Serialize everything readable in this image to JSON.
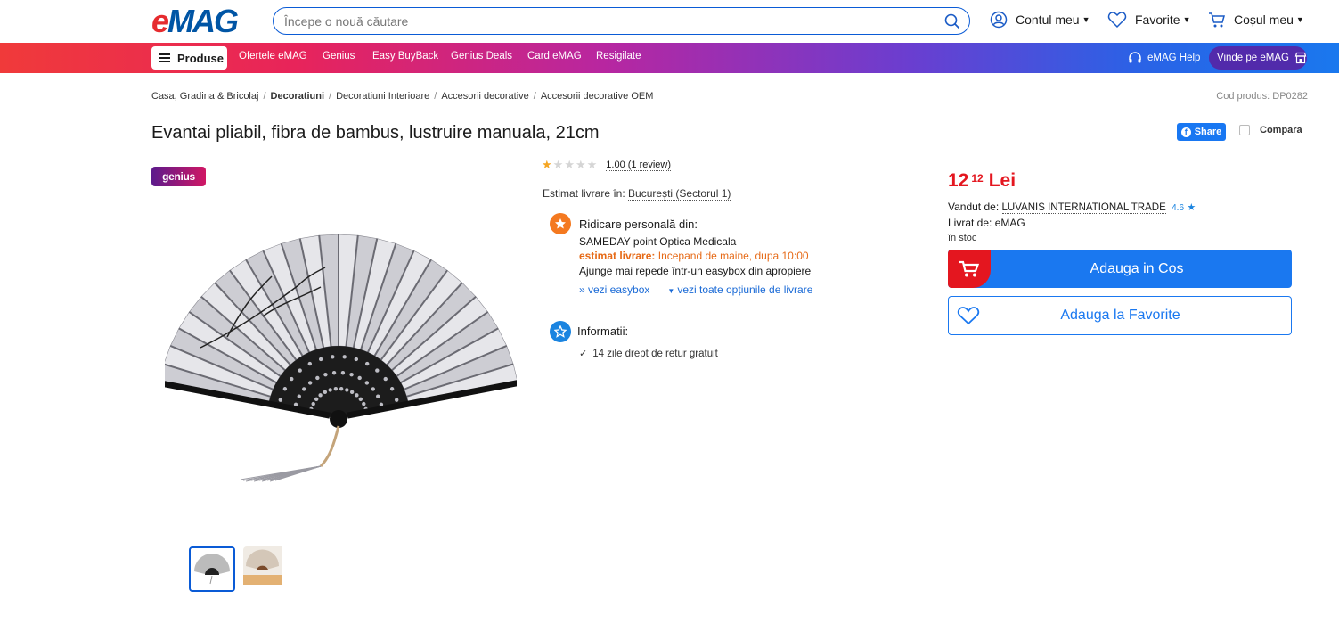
{
  "header": {
    "logo": "eMAG",
    "search_placeholder": "Începe o nouă căutare",
    "account": "Contul meu",
    "favorites": "Favorite",
    "cart": "Coșul meu"
  },
  "nav": {
    "products": "Produse",
    "items": [
      "Ofertele eMAG",
      "Genius",
      "Easy BuyBack",
      "Genius Deals",
      "Card eMAG",
      "Resigilate"
    ],
    "help": "eMAG Help",
    "sell": "Vinde pe eMAG"
  },
  "breadcrumb": [
    "Casa, Gradina & Bricolaj",
    "Decoratiuni",
    "Decoratiuni Interioare",
    "Accesorii decorative",
    "Accesorii decorative OEM"
  ],
  "product_code": "Cod produs: DP0282",
  "product": {
    "title": "Evantai pliabil, fibra de bambus, lustruire manuala, 21cm",
    "share": "Share",
    "compare": "Compara",
    "genius_badge": "genius",
    "rating_stars": 1,
    "rating_text": "1.00 (1 review)"
  },
  "delivery": {
    "estimate_label": "Estimat livrare în:",
    "city": "București (Sectorul 1)",
    "pickup_title": "Ridicare personală din:",
    "pickup_point": "SAMEDAY point Optica Medicala",
    "pickup_est_label": "estimat livrare:",
    "pickup_est_value": "Incepand de maine, dupa 10:00",
    "pickup_note": "Ajunge mai repede într-un easybox din apropiere",
    "link_easybox": "» vezi easybox",
    "link_options": "vezi toate opțiunile de livrare",
    "info_title": "Informatii:",
    "return_policy": "14 zile drept de retur gratuit"
  },
  "purchase": {
    "price_int": "12",
    "price_dec": "12",
    "currency": "Lei",
    "sold_by_label": "Vandut de:",
    "seller": "LUVANIS INTERNATIONAL TRADE",
    "seller_rating": "4.6",
    "delivered_by": "Livrat de: eMAG",
    "stock": "în stoc",
    "add_to_cart": "Adauga in Cos",
    "add_to_fav": "Adauga la Favorite"
  },
  "colors": {
    "brand_blue": "#1a78f0",
    "brand_red": "#e4161f",
    "pickup_orange": "#f47920"
  }
}
